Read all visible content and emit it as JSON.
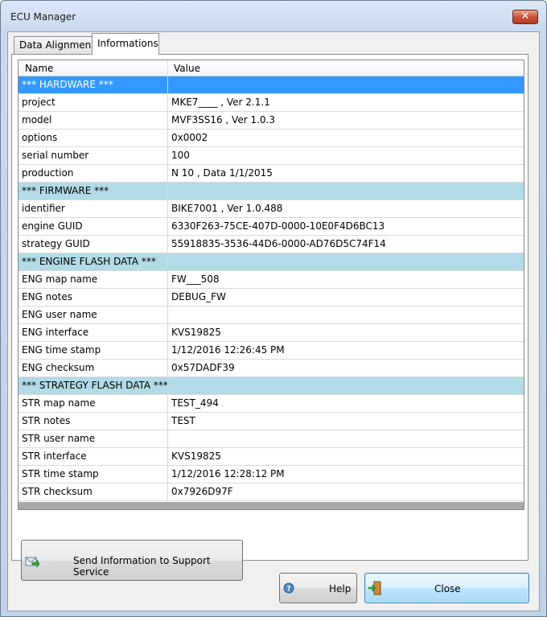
{
  "window": {
    "title": "ECU Manager",
    "close_glyph": "✕"
  },
  "tabs": [
    {
      "label": "Data Alignment",
      "active": false
    },
    {
      "label": "Informations",
      "active": true
    }
  ],
  "grid": {
    "columns": [
      "Name",
      "Value"
    ],
    "rows": [
      {
        "name": "*** HARDWARE ***",
        "value": "",
        "kind": "section-selected"
      },
      {
        "name": "project",
        "value": "MKE7____ , Ver 2.1.1",
        "kind": "data"
      },
      {
        "name": "model",
        "value": "MVF3SS16 , Ver 1.0.3",
        "kind": "data"
      },
      {
        "name": "options",
        "value": "0x0002",
        "kind": "data"
      },
      {
        "name": "serial number",
        "value": "100",
        "kind": "data"
      },
      {
        "name": "production",
        "value": "N 10 , Data 1/1/2015",
        "kind": "data"
      },
      {
        "name": "*** FIRMWARE ***",
        "value": "",
        "kind": "section"
      },
      {
        "name": "identifier",
        "value": "BIKE7001 , Ver 1.0.488",
        "kind": "data"
      },
      {
        "name": "engine GUID",
        "value": "6330F263-75CE-407D-0000-10E0F4D6BC13",
        "kind": "data"
      },
      {
        "name": "strategy GUID",
        "value": "55918835-3536-44D6-0000-AD76D5C74F14",
        "kind": "data"
      },
      {
        "name": "*** ENGINE FLASH DATA ***",
        "value": "",
        "kind": "section"
      },
      {
        "name": "ENG map name",
        "value": "FW___508",
        "kind": "data"
      },
      {
        "name": "ENG notes",
        "value": "DEBUG_FW",
        "kind": "data"
      },
      {
        "name": "ENG user name",
        "value": "",
        "kind": "data"
      },
      {
        "name": "ENG interface",
        "value": "KVS19825",
        "kind": "data"
      },
      {
        "name": "ENG time stamp",
        "value": "1/12/2016 12:26:45 PM",
        "kind": "data"
      },
      {
        "name": "ENG checksum",
        "value": "0x57DADF39",
        "kind": "data"
      },
      {
        "name": "*** STRATEGY FLASH DATA ***",
        "value": "",
        "kind": "section"
      },
      {
        "name": "STR map name",
        "value": "TEST_494",
        "kind": "data"
      },
      {
        "name": "STR notes",
        "value": "TEST",
        "kind": "data"
      },
      {
        "name": "STR user name",
        "value": "",
        "kind": "data"
      },
      {
        "name": "STR interface",
        "value": "KVS19825",
        "kind": "data"
      },
      {
        "name": "STR time stamp",
        "value": "1/12/2016 12:28:12 PM",
        "kind": "data"
      },
      {
        "name": "STR checksum",
        "value": "0x7926D97F",
        "kind": "data"
      }
    ]
  },
  "buttons": {
    "send_label": "Send Information to Support Service",
    "send_icon": "send-mail-icon",
    "help_label": "Help",
    "help_icon": "help-icon",
    "close_label": "Close",
    "close_icon": "exit-door-icon"
  },
  "colors": {
    "section_row": "#b1dbe6",
    "selected_row": "#3399ff"
  }
}
